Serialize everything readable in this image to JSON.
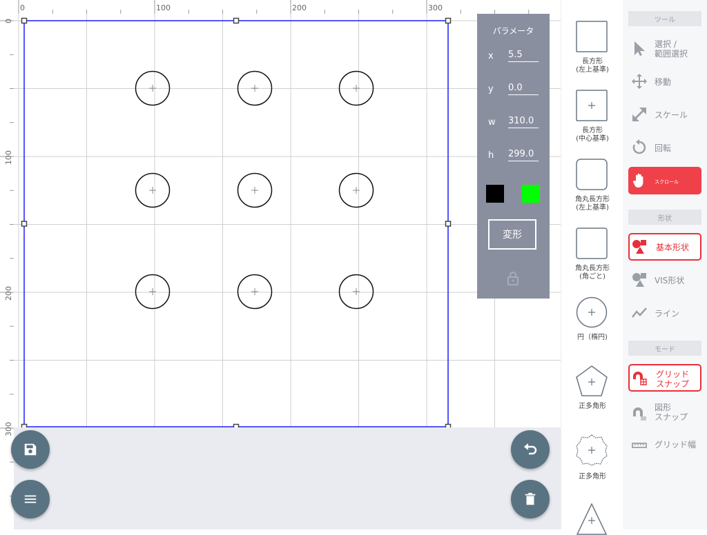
{
  "canvas": {
    "ruler_top_labels": [
      "0",
      "100",
      "200",
      "300"
    ],
    "ruler_left_labels": [
      "0",
      "100",
      "200",
      "300"
    ]
  },
  "param_panel": {
    "title": "パラメータ",
    "fields": [
      {
        "label": "x",
        "value": "5.5"
      },
      {
        "label": "y",
        "value": "0.0"
      },
      {
        "label": "w",
        "value": "310.0"
      },
      {
        "label": "h",
        "value": "299.0"
      }
    ],
    "stroke_color": "#000000",
    "fill_color": "#00ff00",
    "transform_label": "変形",
    "lock_icon": "lock-icon"
  },
  "shapes": [
    {
      "label": "長方形\n(左上基準)",
      "icon": "rectangle-icon"
    },
    {
      "label": "長方形\n(中心基準)",
      "icon": "rectangle-center-icon"
    },
    {
      "label": "角丸長方形\n(左上基準)",
      "icon": "rounded-rectangle-icon"
    },
    {
      "label": "角丸長方形\n(角ごと)",
      "icon": "rounded-rectangle-corner-icon"
    },
    {
      "label": "円（楕円)",
      "icon": "circle-icon"
    },
    {
      "label": "正多角形",
      "icon": "pentagon-icon"
    },
    {
      "label": "正多角形",
      "icon": "star-polygon-icon"
    }
  ],
  "tools": {
    "tool_header": "ツール",
    "select_label": "選択 /\n範囲選択",
    "move_label": "移動",
    "scale_label": "スケール",
    "rotate_label": "回転",
    "scroll_label": "スクロール",
    "shape_header": "形状",
    "basic_shape_label": "基本形状",
    "vis_shape_label": "VIS形状",
    "line_label": "ライン",
    "mode_header": "モード",
    "grid_snap_label": "グリッド\nスナップ",
    "shape_snap_label": "図形\nスナップ",
    "grid_width_label": "グリッド幅"
  },
  "colors": {
    "accent": "#e8303a",
    "panel": "#8a8fa0",
    "fab": "#5a7382",
    "selection": "#1a1aff"
  },
  "fabs": [
    "save-icon",
    "menu-icon",
    "undo-icon",
    "trash-icon"
  ]
}
